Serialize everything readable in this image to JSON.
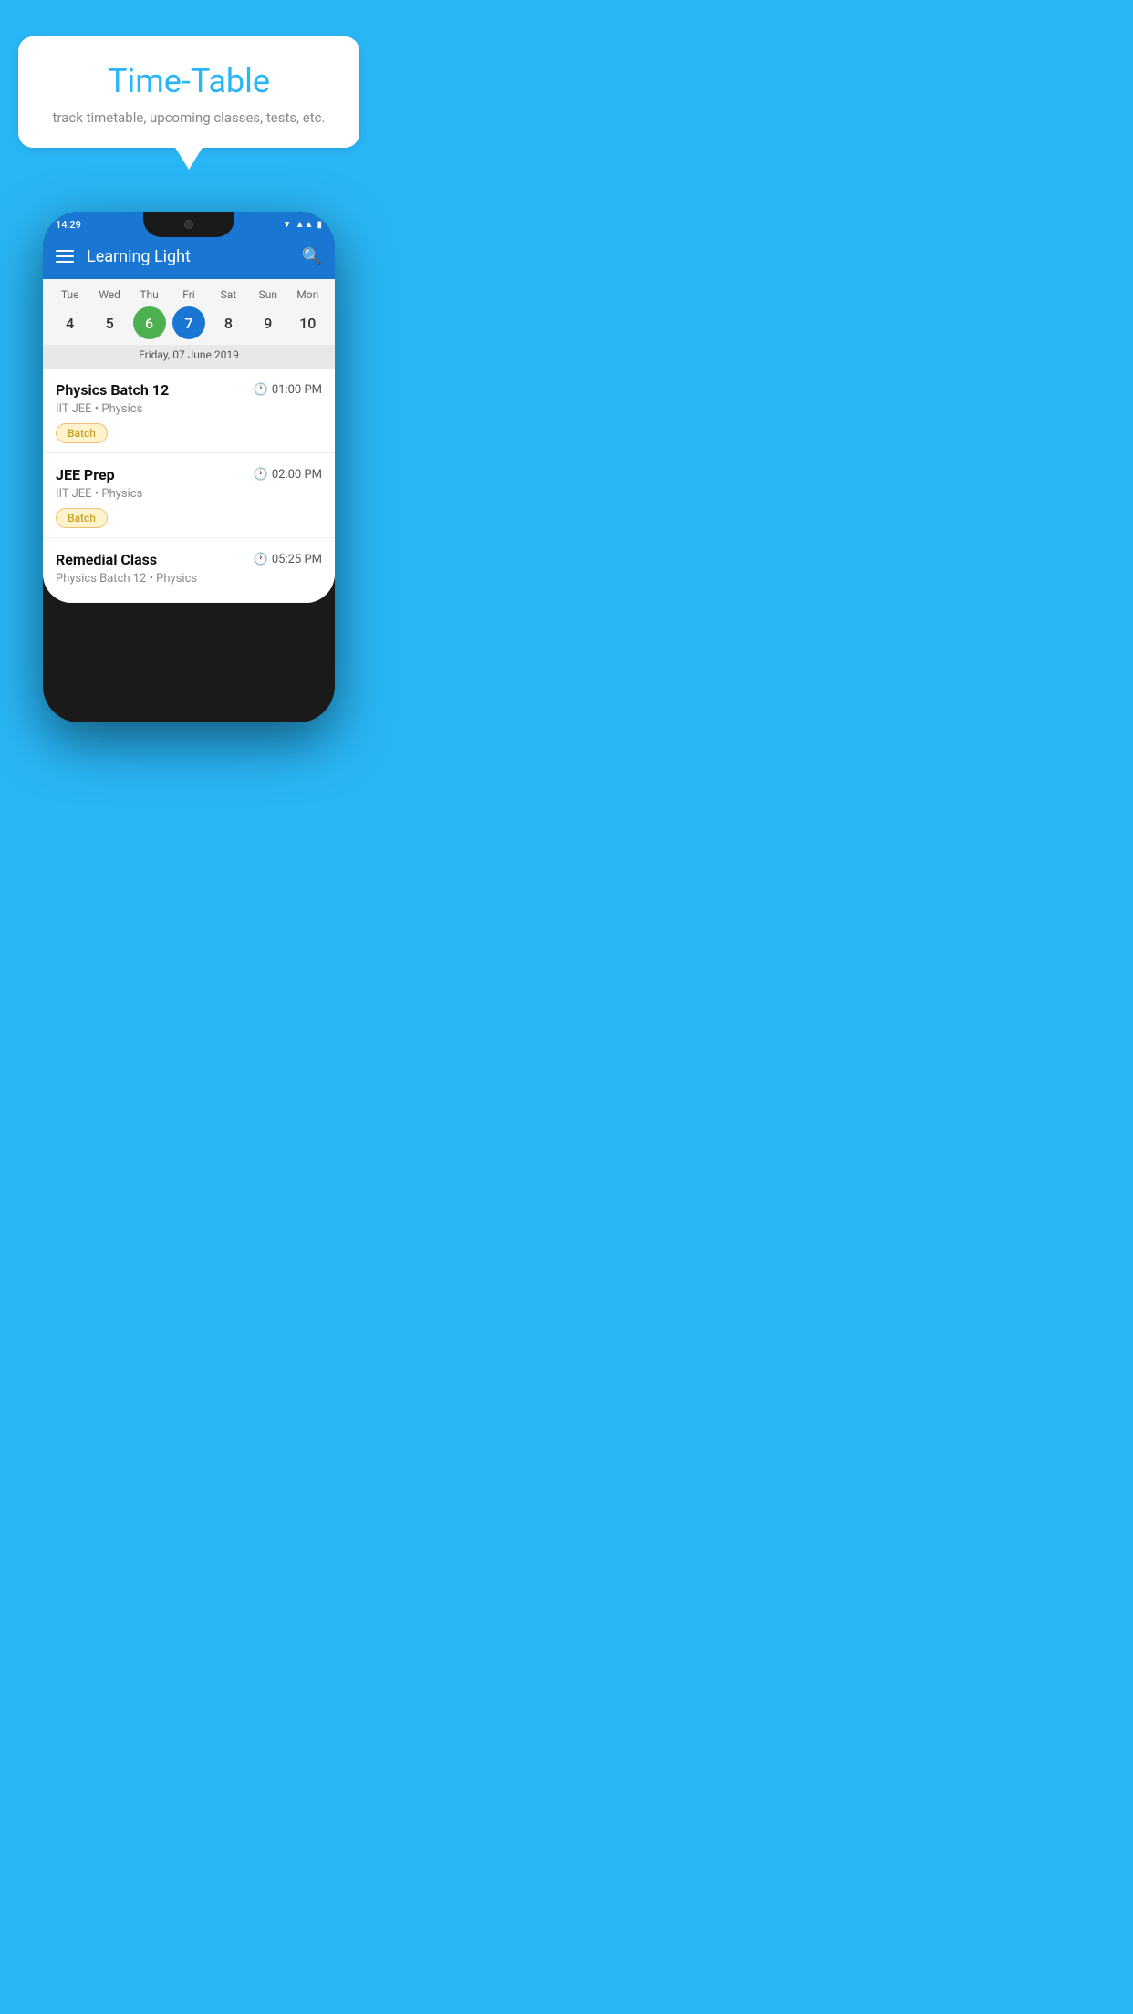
{
  "background_color": "#29B6F6",
  "bubble": {
    "title": "Time-Table",
    "subtitle": "track timetable, upcoming classes, tests, etc."
  },
  "phone": {
    "status_bar": {
      "time": "14:29"
    },
    "app_bar": {
      "title": "Learning Light"
    },
    "calendar": {
      "days": [
        "Tue",
        "Wed",
        "Thu",
        "Fri",
        "Sat",
        "Sun",
        "Mon"
      ],
      "numbers": [
        "4",
        "5",
        "6",
        "7",
        "8",
        "9",
        "10"
      ],
      "today_index": 2,
      "selected_index": 3,
      "selected_date": "Friday, 07 June 2019"
    },
    "schedule": [
      {
        "name": "Physics Batch 12",
        "time": "01:00 PM",
        "meta": "IIT JEE • Physics",
        "badge": "Batch"
      },
      {
        "name": "JEE Prep",
        "time": "02:00 PM",
        "meta": "IIT JEE • Physics",
        "badge": "Batch"
      },
      {
        "name": "Remedial Class",
        "time": "05:25 PM",
        "meta": "Physics Batch 12 • Physics",
        "badge": null
      }
    ]
  }
}
